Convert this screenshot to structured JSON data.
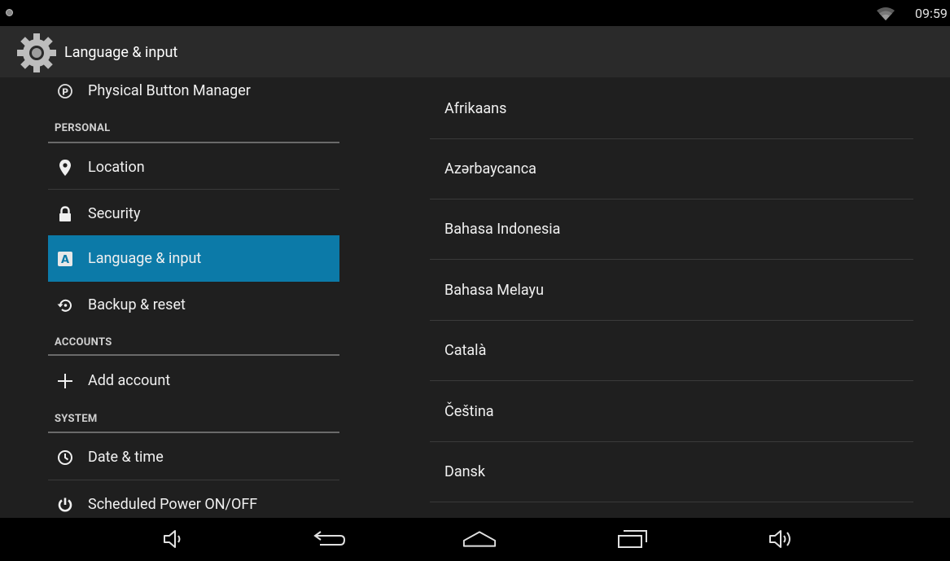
{
  "status_bar": {
    "time": "09:59"
  },
  "action_bar": {
    "title": "Language & input",
    "icon": "settings-gear-icon"
  },
  "left_menu": {
    "items": [
      {
        "id": "physical-button",
        "label": "Physical Button Manager",
        "icon": "p-circle-icon"
      },
      {
        "id": "location",
        "label": "Location",
        "icon": "location-pin-icon"
      },
      {
        "id": "security",
        "label": "Security",
        "icon": "lock-icon"
      },
      {
        "id": "language",
        "label": "Language & input",
        "icon": "keyboard-a-icon",
        "selected": true
      },
      {
        "id": "backup",
        "label": "Backup & reset",
        "icon": "restore-icon"
      },
      {
        "id": "add-account",
        "label": "Add account",
        "icon": "plus-icon"
      },
      {
        "id": "date-time",
        "label": "Date & time",
        "icon": "clock-icon"
      },
      {
        "id": "scheduled-power",
        "label": "Scheduled Power ON/OFF",
        "icon": "power-icon"
      }
    ],
    "headers": {
      "personal": "PERSONAL",
      "accounts": "ACCOUNTS",
      "system": "SYSTEM"
    }
  },
  "languages": [
    "Afrikaans",
    "Azərbaycanca",
    "Bahasa Indonesia",
    "Bahasa Melayu",
    "Català",
    "Čeština",
    "Dansk"
  ],
  "nav_bar": [
    "volume-down-icon",
    "back-icon",
    "home-icon",
    "recents-icon",
    "volume-up-icon"
  ],
  "colors": {
    "selected": "#0c7aa8",
    "background": "#1f1f1f"
  }
}
